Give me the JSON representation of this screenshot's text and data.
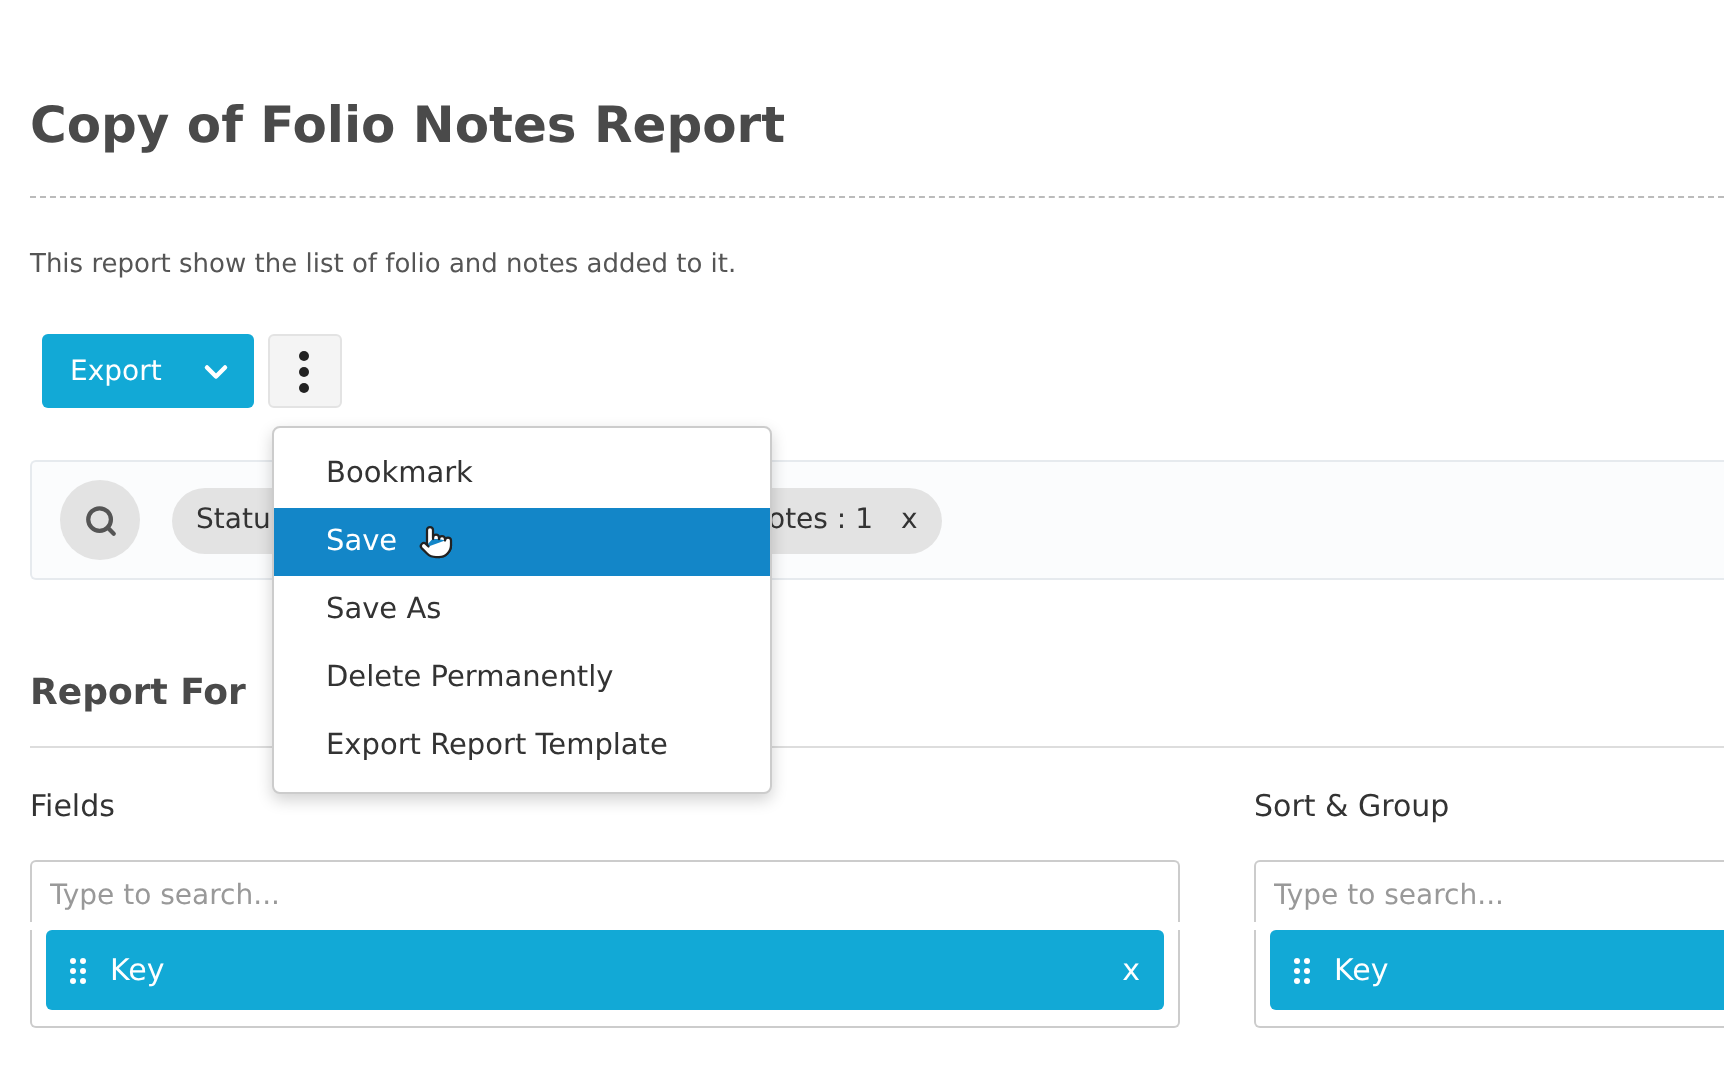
{
  "title": "Copy of Folio Notes Report",
  "description": "This report show the list of folio and notes added to it.",
  "toolbar": {
    "export_label": "Export"
  },
  "filters": [
    {
      "label": "Statu"
    },
    {
      "label": "otes : 1",
      "remove": "x"
    }
  ],
  "section_title": "Report For",
  "menu": {
    "items": [
      {
        "label": "Bookmark",
        "selected": false
      },
      {
        "label": "Save",
        "selected": true
      },
      {
        "label": "Save As",
        "selected": false
      },
      {
        "label": "Delete Permanently",
        "selected": false
      },
      {
        "label": "Export Report Template",
        "selected": false
      }
    ]
  },
  "panels": [
    {
      "heading": "Fields",
      "placeholder": "Type to search...",
      "items": [
        {
          "label": "Key",
          "remove": "x"
        }
      ]
    },
    {
      "heading": "Sort & Group",
      "placeholder": "Type to search...",
      "items": [
        {
          "label": "Key"
        }
      ]
    }
  ]
}
